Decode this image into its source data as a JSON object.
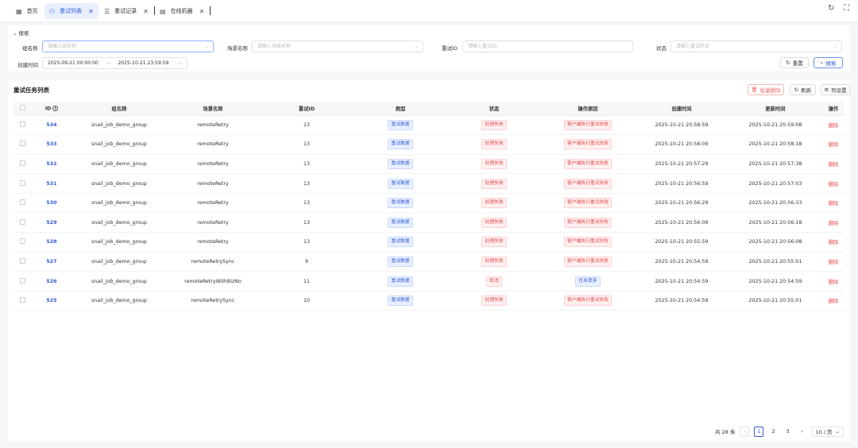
{
  "tabs": [
    {
      "label": "首页",
      "icon": "dashboard-icon"
    },
    {
      "label": "重试列表",
      "icon": "retry-list-icon"
    },
    {
      "label": "重试记录",
      "icon": "list-icon"
    },
    {
      "label": "在线机器",
      "icon": "server-icon"
    }
  ],
  "search": {
    "toggle_label": "搜索",
    "group_label": "组名称",
    "group_placeholder": "请输入组名称",
    "scene_label": "场景名称",
    "scene_placeholder": "请输入场景名称",
    "retry_id_label": "重试ID",
    "retry_id_placeholder": "请输入重试ID",
    "status_label": "状态",
    "status_placeholder": "请输入重试状态",
    "created_label": "创建时间",
    "date_start": "2025-09-21 00:00:00",
    "date_end": "2025-10-21 23:59:59",
    "reset_label": "重置",
    "search_label": "搜索"
  },
  "panel": {
    "title": "重试任务列表",
    "batch_delete_label": "批量删除",
    "refresh_label": "刷新",
    "column_settings_label": "列设置"
  },
  "table": {
    "headers": [
      "ID",
      "组名称",
      "场景名称",
      "重试ID",
      "类型",
      "状态",
      "操作原因",
      "创建时间",
      "更新时间",
      "操作"
    ],
    "rows": [
      {
        "id": "534",
        "group": "snail_job_demo_group",
        "scene": "remoteRetry",
        "retry_id": "13",
        "type": "重试数据",
        "status": "处理失败",
        "reason": "客户端执行重试失败",
        "created": "2025-10-21 20:58:59",
        "updated": "2025-10-21 20:59:08",
        "action": "删除"
      },
      {
        "id": "533",
        "group": "snail_job_demo_group",
        "scene": "remoteRetry",
        "retry_id": "13",
        "type": "重试数据",
        "status": "处理失败",
        "reason": "客户端执行重试失败",
        "created": "2025-10-21 20:58:09",
        "updated": "2025-10-21 20:58:18",
        "action": "删除"
      },
      {
        "id": "532",
        "group": "snail_job_demo_group",
        "scene": "remoteRetry",
        "retry_id": "13",
        "type": "重试数据",
        "status": "处理失败",
        "reason": "客户端执行重试失败",
        "created": "2025-10-21 20:57:29",
        "updated": "2025-10-21 20:57:38",
        "action": "删除"
      },
      {
        "id": "531",
        "group": "snail_job_demo_group",
        "scene": "remoteRetry",
        "retry_id": "13",
        "type": "重试数据",
        "status": "处理失败",
        "reason": "客户端执行重试失败",
        "created": "2025-10-21 20:56:59",
        "updated": "2025-10-21 20:57:03",
        "action": "删除"
      },
      {
        "id": "530",
        "group": "snail_job_demo_group",
        "scene": "remoteRetry",
        "retry_id": "13",
        "type": "重试数据",
        "status": "处理失败",
        "reason": "客户端执行重试失败",
        "created": "2025-10-21 20:56:29",
        "updated": "2025-10-21 20:56:33",
        "action": "删除"
      },
      {
        "id": "529",
        "group": "snail_job_demo_group",
        "scene": "remoteRetry",
        "retry_id": "13",
        "type": "重试数据",
        "status": "处理失败",
        "reason": "客户端执行重试失败",
        "created": "2025-10-21 20:56:09",
        "updated": "2025-10-21 20:56:18",
        "action": "删除"
      },
      {
        "id": "528",
        "group": "snail_job_demo_group",
        "scene": "remoteRetry",
        "retry_id": "13",
        "type": "重试数据",
        "status": "处理失败",
        "reason": "客户端执行重试失败",
        "created": "2025-10-21 20:55:59",
        "updated": "2025-10-21 20:56:08",
        "action": "删除"
      },
      {
        "id": "527",
        "group": "snail_job_demo_group",
        "scene": "remoteRetrySync",
        "retry_id": "9",
        "type": "重试数据",
        "status": "处理失败",
        "reason": "客户端执行重试失败",
        "created": "2025-10-21 20:54:59",
        "updated": "2025-10-21 20:55:01",
        "action": "删除"
      },
      {
        "id": "526",
        "group": "snail_job_demo_group",
        "scene": "remoteRetryWithBizNo",
        "retry_id": "11",
        "type": "重试数据",
        "status": "取消",
        "reason": "任务丢弃",
        "created": "2025-10-21 20:54:59",
        "updated": "2025-10-21 20:54:59",
        "action": "删除"
      },
      {
        "id": "525",
        "group": "snail_job_demo_group",
        "scene": "remoteRetrySync",
        "retry_id": "10",
        "type": "重试数据",
        "status": "处理失败",
        "reason": "客户端执行重试失败",
        "created": "2025-10-21 20:54:59",
        "updated": "2025-10-21 20:55:01",
        "action": "删除"
      }
    ]
  },
  "pagination": {
    "total": "共 28 条",
    "pages": [
      "1",
      "2",
      "3"
    ],
    "current": "1",
    "page_size": "10 / 页"
  }
}
